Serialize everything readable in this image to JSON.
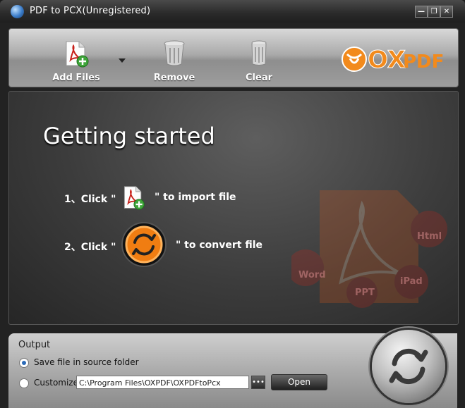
{
  "window": {
    "title": "PDF to PCX(Unregistered)",
    "controls": [
      "minimize",
      "restore",
      "close"
    ]
  },
  "toolbar": {
    "add_files_label": "Add Files",
    "remove_label": "Remove",
    "clear_label": "Clear",
    "logo_ox": "OX",
    "logo_pdf": "PDF"
  },
  "main": {
    "heading": "Getting started",
    "step1_prefix": "1、Click \"",
    "step1_suffix": "\" to import file",
    "step2_prefix": "2、Click \"",
    "step2_suffix": "\" to convert file",
    "decor_labels": [
      "Html",
      "Word",
      "PPT",
      "iPad"
    ]
  },
  "output": {
    "label": "Output",
    "option_source": "Save file in source folder",
    "option_custom": "Customize",
    "selected": "source",
    "path_value": "C:\\Program Files\\OXPDF\\OXPDFtoPcx",
    "browse_label": "•••",
    "open_label": "Open"
  },
  "colors": {
    "accent_orange": "#f07d12",
    "logo_orange": "#f28a1c",
    "radio_selected": "#2c6bb8"
  }
}
